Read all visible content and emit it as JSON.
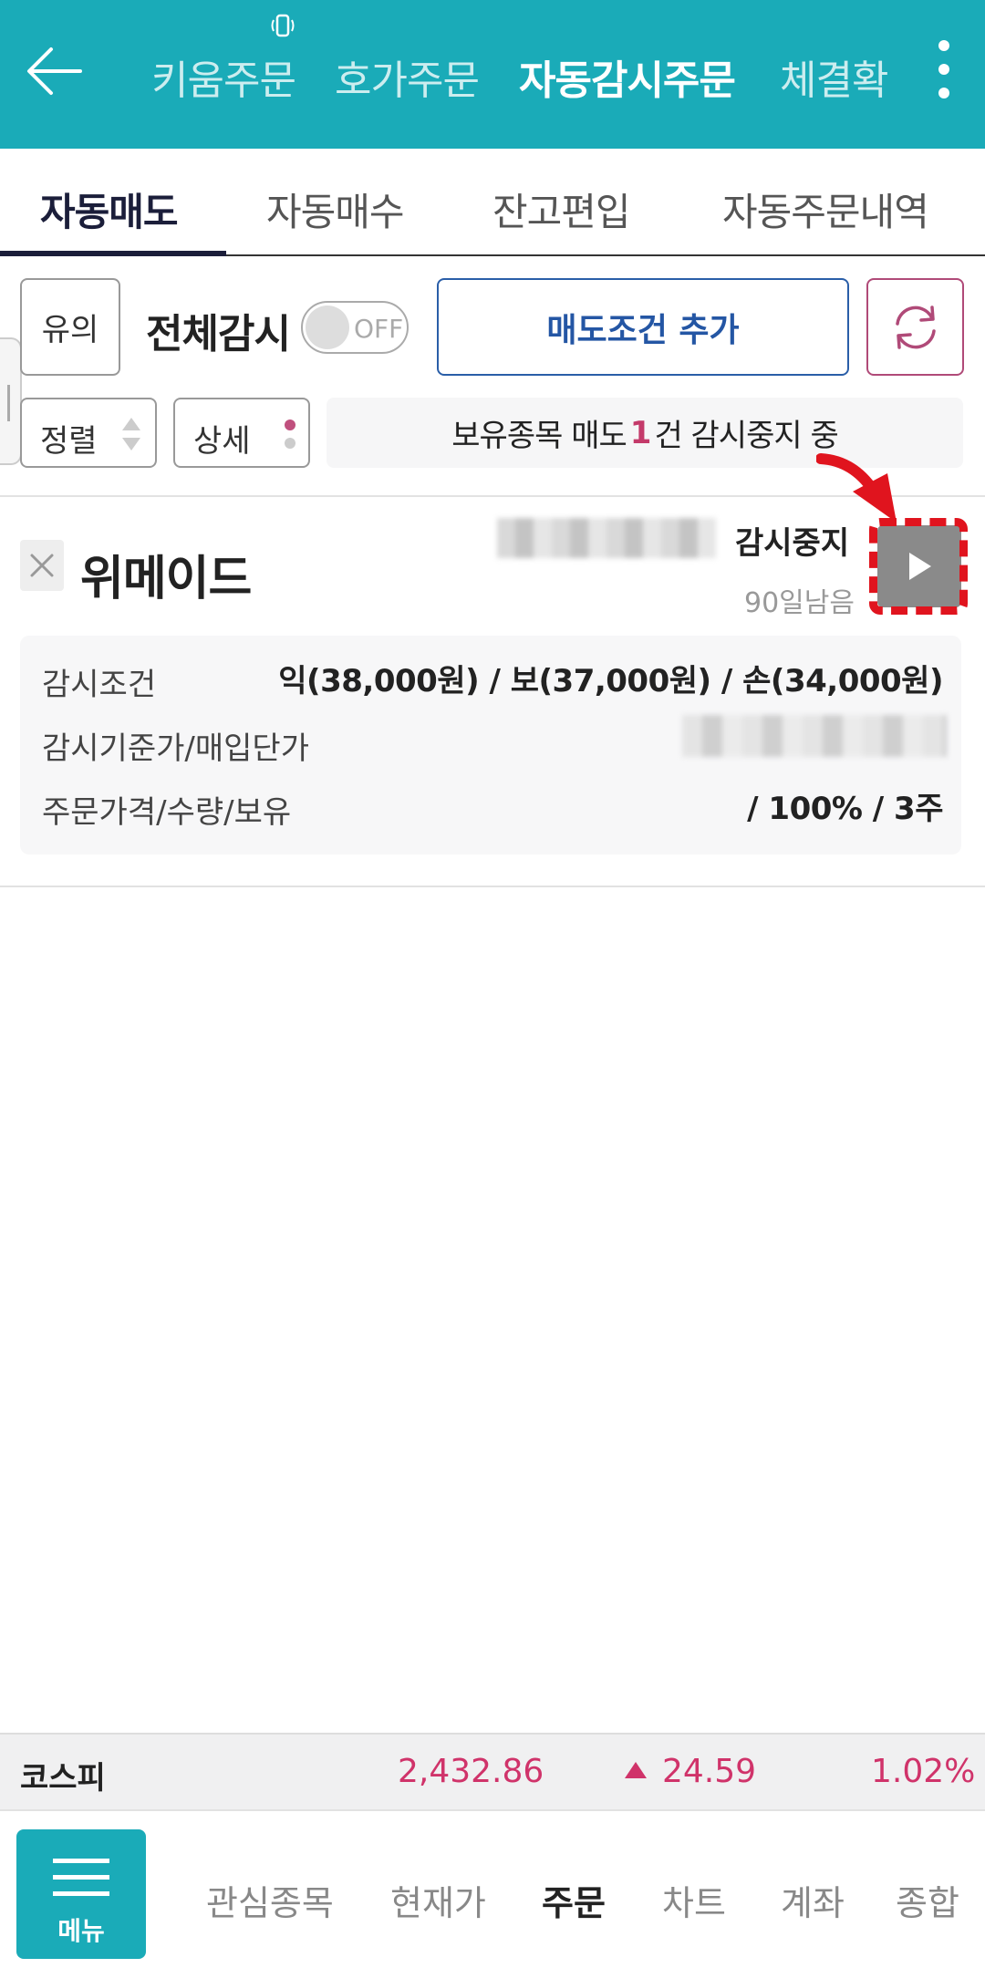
{
  "header": {
    "tabs": [
      {
        "label": "키움주문"
      },
      {
        "label": "호가주문"
      },
      {
        "label": "자동감시주문"
      },
      {
        "label": "체결확"
      }
    ],
    "accent_color": "#1aabb8"
  },
  "subtabs": [
    {
      "label": "자동매도"
    },
    {
      "label": "자동매수"
    },
    {
      "label": "잔고편입"
    },
    {
      "label": "자동주문내역"
    }
  ],
  "controls": {
    "caution_label": "유의",
    "all_monitor_label": "전체감시",
    "toggle_state": "OFF",
    "add_condition_label": "매도조건 추가",
    "sort_label": "정렬",
    "detail_label": "상세",
    "status_prefix": "보유종목 매도",
    "status_count": "1",
    "status_suffix": "건 감시중지 중"
  },
  "stock": {
    "name": "위메이드",
    "monitor_status": "감시중지",
    "days_left": "90일남음",
    "rows": [
      {
        "label": "감시조건",
        "value": "익(38,000원) / 보(37,000원) / 손(34,000원)"
      },
      {
        "label": "감시기준가/매입단가",
        "value": ""
      },
      {
        "label": "주문가격/수량/보유",
        "value": "/ 100% / 3주"
      }
    ]
  },
  "index": {
    "name": "코스피",
    "value": "2,432.86",
    "change": "24.59",
    "change_pct": "1.02%",
    "up_color": "#d0336a"
  },
  "bottom_nav": {
    "menu_label": "메뉴",
    "items": [
      {
        "label": "관심종목"
      },
      {
        "label": "현재가"
      },
      {
        "label": "주문"
      },
      {
        "label": "차트"
      },
      {
        "label": "계좌"
      },
      {
        "label": "종합"
      }
    ]
  }
}
